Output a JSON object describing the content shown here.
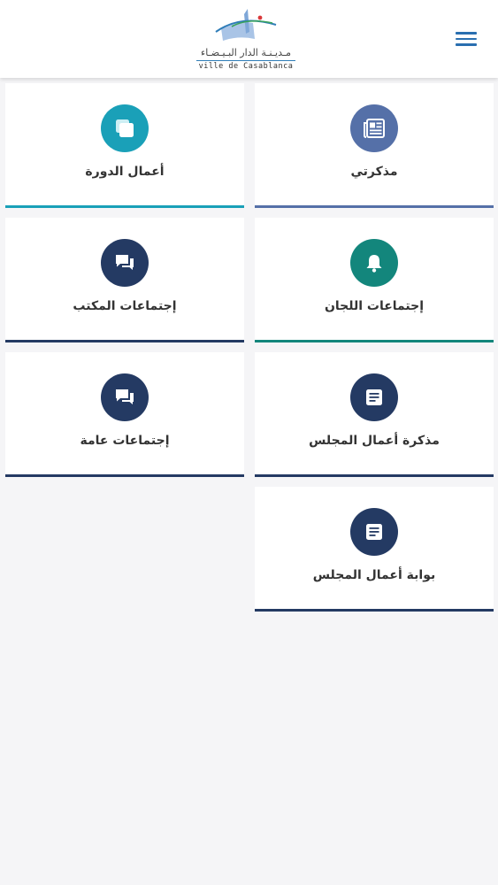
{
  "header": {
    "logo_ar": "مـديـنـة الدار البـيـضـاء",
    "logo_fr": "ville de Casablanca"
  },
  "colors": {
    "accent": "#2a6fb0",
    "teal": "#1aa0b8",
    "slate": "#5570a8",
    "green_teal": "#13867c",
    "navy": "#243a63"
  },
  "cards": [
    {
      "label": "مذكرتي",
      "icon": "newspaper-icon",
      "color": "#5570a8"
    },
    {
      "label": "أعمال الدورة",
      "icon": "copy-icon",
      "color": "#1aa0b8"
    },
    {
      "label": "إجتماعات اللجان",
      "icon": "bell-icon",
      "color": "#13867c"
    },
    {
      "label": "إجتماعات المكتب",
      "icon": "chat-icon",
      "color": "#243a63"
    },
    {
      "label": "مذكرة أعمال المجلس",
      "icon": "document-icon",
      "color": "#243a63"
    },
    {
      "label": "إجتماعات عامة",
      "icon": "chat-icon",
      "color": "#243a63"
    },
    {
      "label": "بوابة أعمال المجلس",
      "icon": "document-icon",
      "color": "#243a63"
    }
  ]
}
